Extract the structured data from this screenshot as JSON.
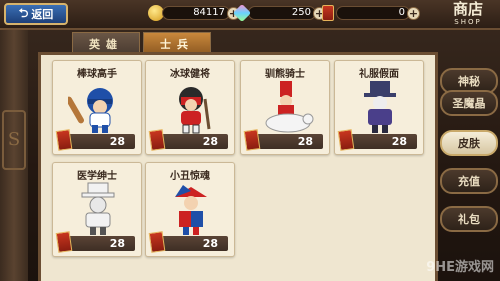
{
  "header": {
    "back_label": "返回",
    "gold": "84117",
    "gems": "250",
    "tickets": "0",
    "shop_title": "商店",
    "shop_subtitle": "SHOP"
  },
  "tabs": [
    {
      "label": "英雄"
    },
    {
      "label": "士兵"
    }
  ],
  "items": [
    {
      "name": "棒球高手",
      "price": "28"
    },
    {
      "name": "冰球健将",
      "price": "28"
    },
    {
      "name": "驯熊骑士",
      "price": "28"
    },
    {
      "name": "礼服假面",
      "price": "28"
    },
    {
      "name": "医学绅士",
      "price": "28"
    },
    {
      "name": "小丑惊魂",
      "price": "28"
    }
  ],
  "side_menu": [
    {
      "label": "神秘"
    },
    {
      "label": "圣魔晶"
    },
    {
      "label": "皮肤"
    },
    {
      "label": "充值"
    },
    {
      "label": "礼包"
    }
  ],
  "watermark": "9HE游戏网",
  "colors": {
    "panel_bg": "#efe6d0",
    "tab_active": "#c9883c",
    "price_bar": "#3e2e24"
  }
}
